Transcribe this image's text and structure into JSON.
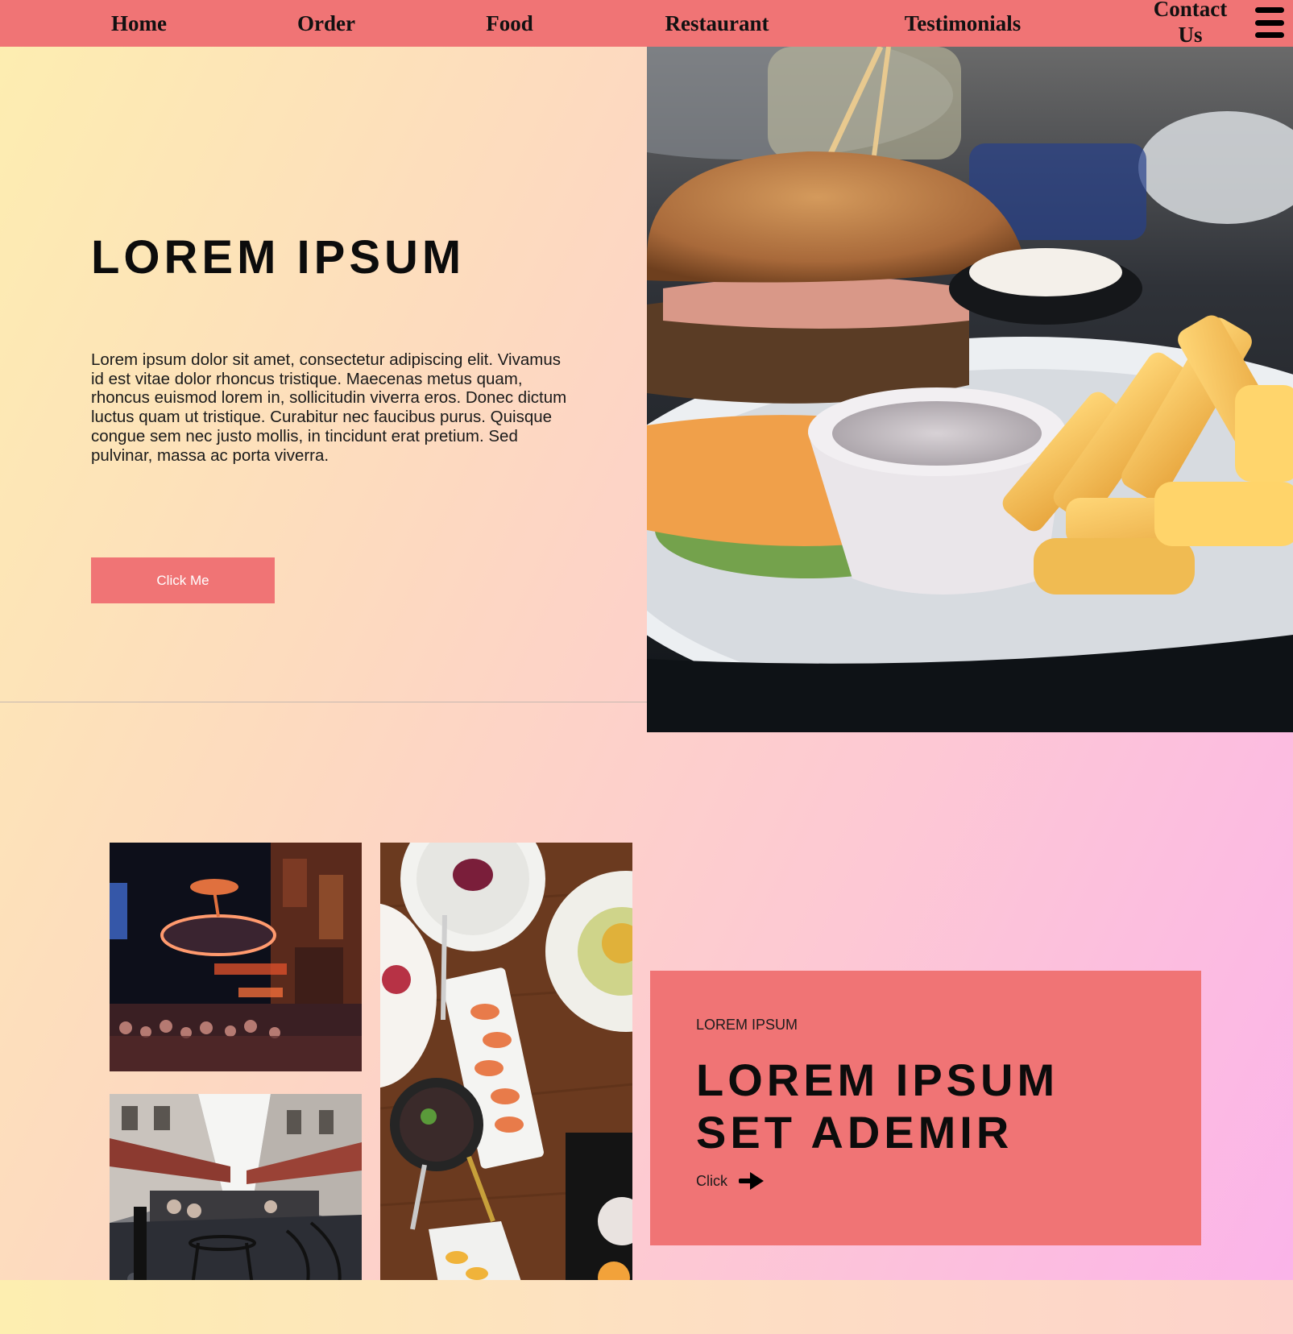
{
  "nav": {
    "items": [
      "Home",
      "Order",
      "Food",
      "Restaurant",
      "Testimonials"
    ],
    "contact": "Contact Us",
    "menu_icon": "hamburger-menu-icon"
  },
  "hero": {
    "title": "LOREM IPSUM",
    "body": "Lorem ipsum dolor sit amet, consectetur adipiscing elit. Vivamus id est vitae dolor rhoncus tristique. Maecenas metus quam, rhoncus euismod lorem in, sollicitudin viverra eros. Donec dictum luctus quam ut tristique. Curabitur nec faucibus purus. Quisque congue sem nec justo mollis, in tincidunt erat pretium. Sed pulvinar, massa ac porta viverra.",
    "button": "Click Me",
    "image": "burger-and-fries-photo"
  },
  "gallery": {
    "images": [
      "stage-neon-sign-street-photo",
      "restaurant-dishes-table-photo",
      "cobblestone-alley-cafe-photo"
    ]
  },
  "promo": {
    "eyebrow": "LOREM IPSUM",
    "title_line1": "LOREM IPSUM",
    "title_line2": "SET ADEMIR",
    "link": "Click",
    "link_icon": "arrow-right-icon"
  },
  "colors": {
    "accent": "#f07475",
    "gradient_start": "#fdeeb0",
    "gradient_end": "#fbb3ea",
    "text": "#0c0c0c"
  }
}
